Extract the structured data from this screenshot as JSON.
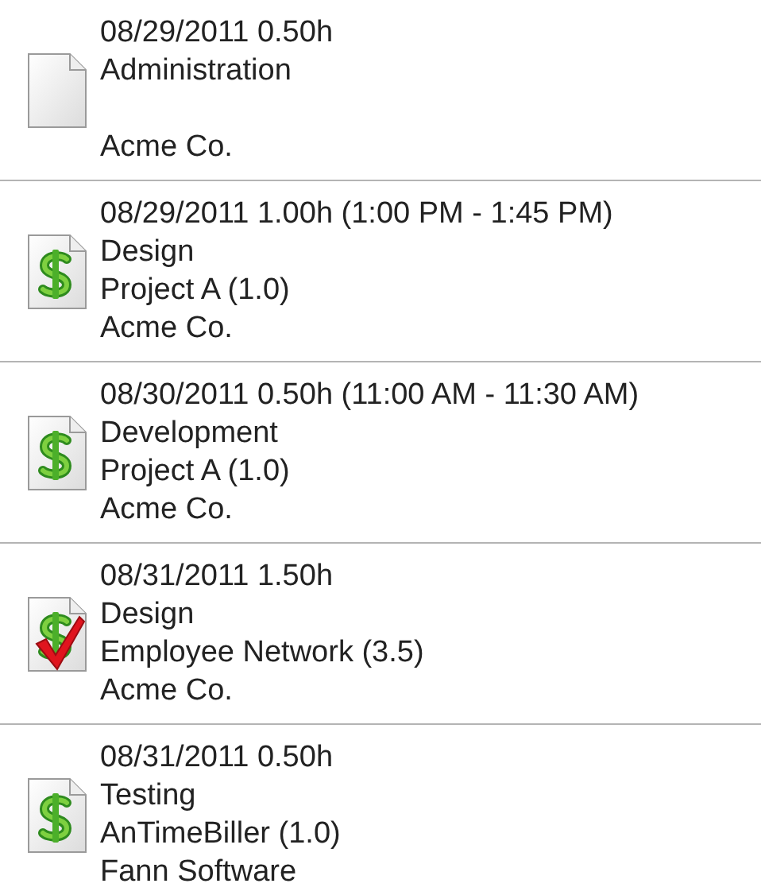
{
  "entries": [
    {
      "kind": "blank",
      "header": "08/29/2011 0.50h",
      "task": "Administration",
      "client": "Acme Co."
    },
    {
      "kind": "billable",
      "header": "08/29/2011 1.00h (1:00 PM - 1:45 PM)",
      "task": "Design",
      "project": "Project A (1.0)",
      "client": "Acme Co."
    },
    {
      "kind": "billable",
      "header": "08/30/2011 0.50h (11:00 AM - 11:30 AM)",
      "task": "Development",
      "project": "Project A (1.0)",
      "client": "Acme Co."
    },
    {
      "kind": "billed",
      "header": "08/31/2011 1.50h",
      "task": "Design",
      "project": "Employee Network (3.5)",
      "client": "Acme Co."
    },
    {
      "kind": "billable",
      "header": "08/31/2011 0.50h",
      "task": "Testing",
      "project": "AnTimeBiller (1.0)",
      "client": "Fann Software"
    }
  ]
}
